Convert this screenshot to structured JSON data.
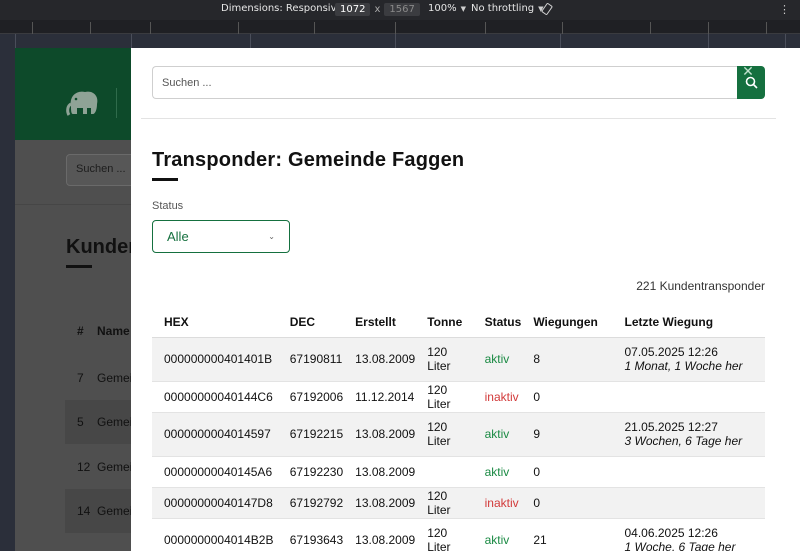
{
  "devtools": {
    "dimensions_label": "Dimensions: Responsive",
    "width": "1072",
    "times": "x",
    "height": "1567",
    "zoom": "100%",
    "throttling": "No throttling"
  },
  "background": {
    "search_placeholder": "Suchen ...",
    "title_fragment": "Kunden",
    "col_num": "#",
    "col_name": "Name",
    "rows": [
      {
        "num": "7",
        "name": "Gemei"
      },
      {
        "num": "5",
        "name": "Gemei"
      },
      {
        "num": "12",
        "name": "Gemei"
      },
      {
        "num": "14",
        "name": "Gemei"
      }
    ]
  },
  "modal": {
    "search_placeholder": "Suchen ...",
    "close_symbol": "✕",
    "title": "Transponder: Gemeinde Faggen",
    "status_label": "Status",
    "status_value": "Alle",
    "count_text": "221 Kundentransponder",
    "columns": [
      "HEX",
      "DEC",
      "Erstellt",
      "Tonne",
      "Status",
      "Wiegungen",
      "Letzte Wiegung"
    ],
    "rows": [
      {
        "hex": "000000000401401B",
        "dec": "67190811",
        "created": "13.08.2009",
        "bin": "120 Liter",
        "status": "aktiv",
        "weighings": "8",
        "last_date": "07.05.2025 12:26",
        "last_rel": "1 Monat, 1 Woche her"
      },
      {
        "hex": "00000000040144C6",
        "dec": "67192006",
        "created": "11.12.2014",
        "bin": "120 Liter",
        "status": "inaktiv",
        "weighings": "0",
        "last_date": "",
        "last_rel": ""
      },
      {
        "hex": "0000000004014597",
        "dec": "67192215",
        "created": "13.08.2009",
        "bin": "120 Liter",
        "status": "aktiv",
        "weighings": "9",
        "last_date": "21.05.2025 12:27",
        "last_rel": "3 Wochen, 6 Tage her"
      },
      {
        "hex": "00000000040145A6",
        "dec": "67192230",
        "created": "13.08.2009",
        "bin": "",
        "status": "aktiv",
        "weighings": "0",
        "last_date": "",
        "last_rel": ""
      },
      {
        "hex": "00000000040147D8",
        "dec": "67192792",
        "created": "13.08.2009",
        "bin": "120 Liter",
        "status": "inaktiv",
        "weighings": "0",
        "last_date": "",
        "last_rel": ""
      },
      {
        "hex": "0000000004014B2B",
        "dec": "67193643",
        "created": "13.08.2009",
        "bin": "120 Liter",
        "status": "aktiv",
        "weighings": "21",
        "last_date": "04.06.2025 12:26",
        "last_rel": "1 Woche, 6 Tage her"
      }
    ]
  },
  "colors": {
    "brand_green": "#15703f",
    "status_active": "#1a8a43",
    "status_inactive": "#d23a3a"
  }
}
